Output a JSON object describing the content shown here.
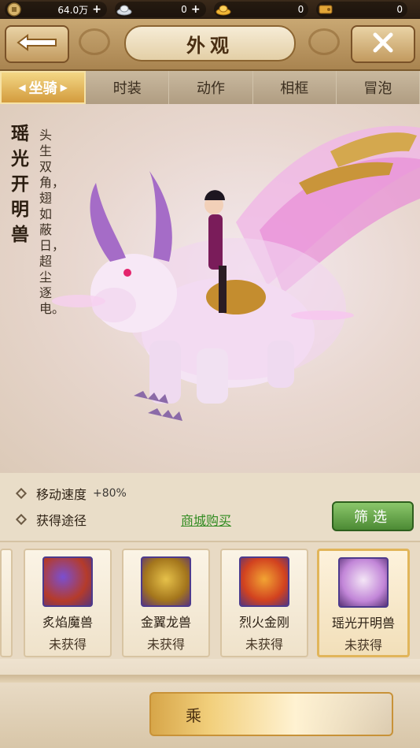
{
  "currency": {
    "silver_coin": "64.0万",
    "ingot": "0",
    "gold": "0",
    "ticket": "0"
  },
  "title": "外观",
  "tabs": [
    {
      "label": "坐骑",
      "active": true
    },
    {
      "label": "时装",
      "active": false
    },
    {
      "label": "动作",
      "active": false
    },
    {
      "label": "相框",
      "active": false
    },
    {
      "label": "冒泡",
      "active": false
    }
  ],
  "mount": {
    "name": "瑶光开明兽",
    "description": "头生双角，翅如蔽日，超尘逐电。"
  },
  "stats": {
    "speed_label": "移动速度",
    "speed_value": "+80%",
    "source_label": "获得途径",
    "source_link": "商城购买"
  },
  "filter_label": "筛选",
  "cards": [
    {
      "name": "炙焰魔兽",
      "status": "未获得"
    },
    {
      "name": "金翼龙兽",
      "status": "未获得"
    },
    {
      "name": "烈火金刚",
      "status": "未获得"
    },
    {
      "name": "瑶光开明兽",
      "status": "未获得"
    }
  ],
  "action_button": "乘",
  "colors": {
    "accent_gold": "#d39b3d",
    "link_green": "#2f8a1f",
    "filter_green": "#4c8a34"
  }
}
